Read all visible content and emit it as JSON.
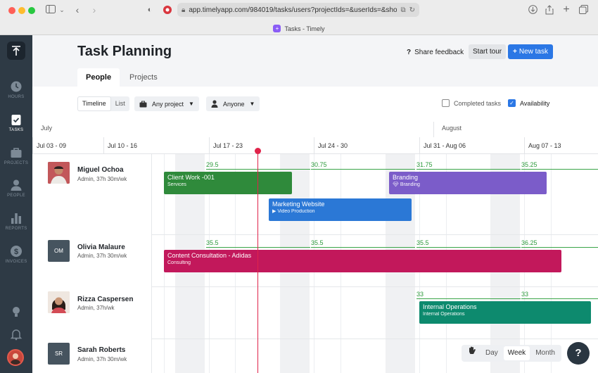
{
  "browser": {
    "url": "app.timelyapp.com/984019/tasks/users?projectIds=&userIds=&show",
    "tab_title": "Tasks - Timely"
  },
  "sidebar": {
    "items": [
      {
        "label": "HOURS",
        "icon": "clock-icon",
        "active": false
      },
      {
        "label": "TASKS",
        "icon": "clipboard-check-icon",
        "active": true
      },
      {
        "label": "PROJECTS",
        "icon": "briefcase-icon",
        "active": false
      },
      {
        "label": "PEOPLE",
        "icon": "person-icon",
        "active": false
      },
      {
        "label": "REPORTS",
        "icon": "bar-chart-icon",
        "active": false
      },
      {
        "label": "INVOICES",
        "icon": "dollar-icon",
        "active": false
      }
    ]
  },
  "header": {
    "title": "Task Planning",
    "feedback_label": "Share feedback",
    "tour_label": "Start tour",
    "new_task_label": "New task",
    "tabs": [
      {
        "label": "People",
        "active": true
      },
      {
        "label": "Projects",
        "active": false
      }
    ]
  },
  "toolbar": {
    "view_timeline": "Timeline",
    "view_list": "List",
    "project_filter": "Any project",
    "person_filter": "Anyone",
    "completed_label": "Completed tasks",
    "completed_checked": false,
    "availability_label": "Availability",
    "availability_checked": true
  },
  "timeline": {
    "months": [
      "July",
      "August"
    ],
    "weeks": [
      "Jul 03 - 09",
      "Jul 10 - 16",
      "Jul 17 - 23",
      "Jul 24 - 30",
      "Jul 31 - Aug 06",
      "Aug 07 - 13"
    ]
  },
  "people": [
    {
      "name": "Miguel Ochoa",
      "sub": "Admin, 37h 30m/wk",
      "initials": "",
      "capacity": [
        "29.5",
        "30.75",
        "31.75",
        "35.25"
      ],
      "tasks": [
        {
          "title": "Client Work -001",
          "sub": "Services",
          "color": "#2f8a3b"
        },
        {
          "title": "Branding",
          "sub": "Branding",
          "color": "#7b5cc9"
        },
        {
          "title": "Marketing Website",
          "sub": "Video Production",
          "color": "#2b78d6"
        }
      ]
    },
    {
      "name": "Olivia Malaure",
      "sub": "Admin, 37h 30m/wk",
      "initials": "OM",
      "capacity": [
        "35.5",
        "35.5",
        "35.5",
        "36.25"
      ],
      "tasks": [
        {
          "title": "Content Consultation - Adidas",
          "sub": "Consulting",
          "color": "#c2185b"
        }
      ]
    },
    {
      "name": "Rizza Caspersen",
      "sub": "Admin, 37h/wk",
      "initials": "",
      "capacity": [
        "33",
        "33"
      ],
      "tasks": [
        {
          "title": "Internal Operations",
          "sub": "Internal Operations",
          "color": "#0d8a6e"
        }
      ]
    },
    {
      "name": "Sarah Roberts",
      "sub": "Admin, 37h 30m/wk",
      "initials": "SR",
      "capacity": [],
      "tasks": []
    }
  ],
  "zoom": {
    "day": "Day",
    "week": "Week",
    "month": "Month",
    "active": "Week"
  },
  "help_label": "?"
}
